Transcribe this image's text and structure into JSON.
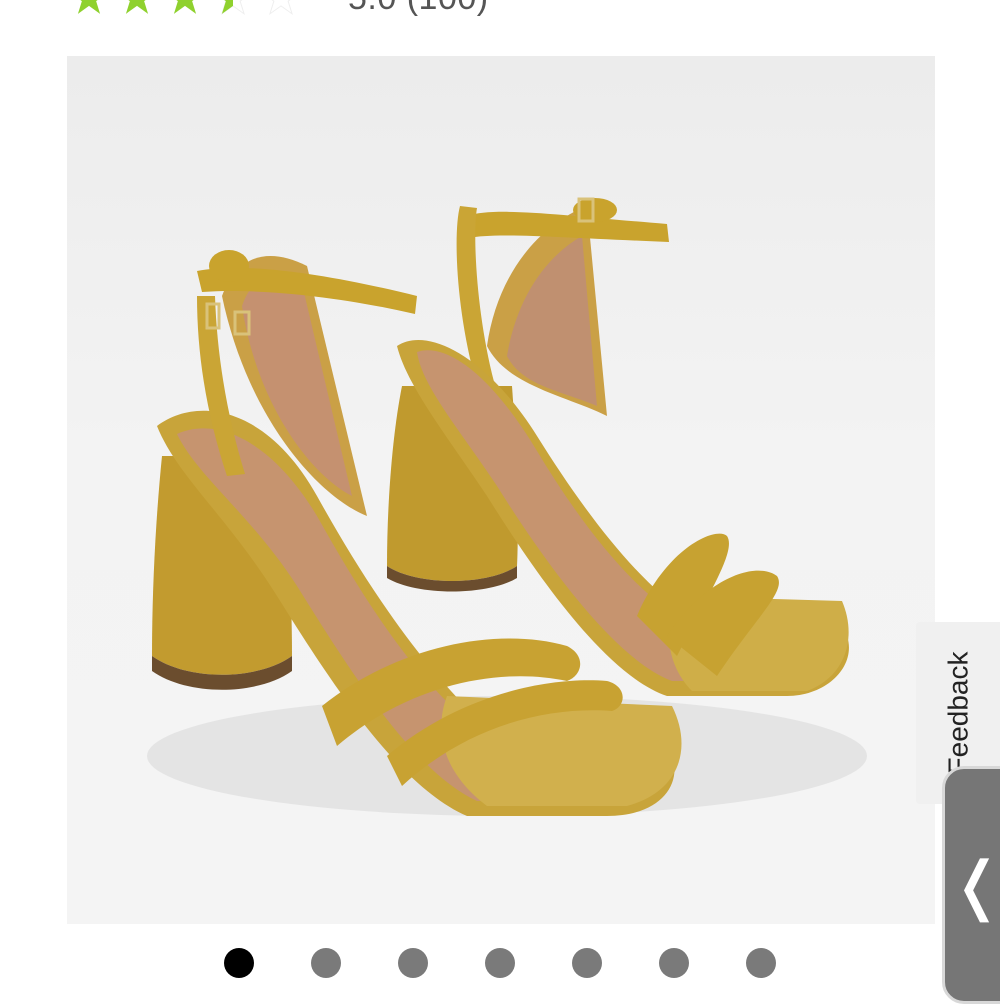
{
  "rating": {
    "value_text": "5.0",
    "count_text": "(100)",
    "stars_filled": 3.5,
    "stars_total": 5,
    "star_color": "#8fd12e",
    "star_empty_color": "#ffffff"
  },
  "product_image": {
    "icon": "product-photo",
    "colors": {
      "velvet": "#c9a52c",
      "insole": "#c8926f",
      "background": "#efefef"
    }
  },
  "carousel": {
    "total": 7,
    "active_index": 0
  },
  "feedback": {
    "label": "Feedback"
  },
  "side_toggle": {
    "label": "❬",
    "color": "#767676"
  }
}
